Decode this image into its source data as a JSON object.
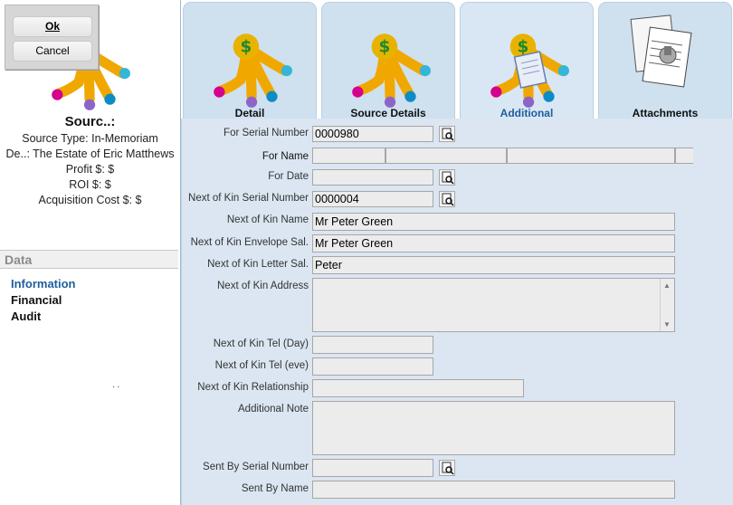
{
  "dialog": {
    "ok_label": "Ok",
    "cancel_label": "Cancel"
  },
  "summary": {
    "title": "Sourc..:",
    "lines": [
      "Source Type: In-Memoriam",
      "De..: The Estate of Eric Matthews",
      "Profit $: $",
      "ROI $: $",
      "Acquisition Cost $: $"
    ]
  },
  "data_section": {
    "header": "Data",
    "items": [
      "Information",
      "Financial",
      "Audit"
    ],
    "active": "Information"
  },
  "footer_dots": ". .",
  "tabs": [
    {
      "label": "Detail",
      "icon": "source-hand-icon"
    },
    {
      "label": "Source Details",
      "icon": "source-hand-icon"
    },
    {
      "label": "Additional",
      "icon": "hand-notepad-icon"
    },
    {
      "label": "Attachments",
      "icon": "paperclip-documents-icon"
    }
  ],
  "active_tab": "Additional",
  "form": {
    "for_serial_number": {
      "label": "For Serial Number",
      "value": "0000980"
    },
    "for_name": {
      "label": "For Name",
      "parts": [
        "",
        "",
        "",
        ""
      ]
    },
    "for_date": {
      "label": "For Date",
      "value": ""
    },
    "nok_serial_number": {
      "label": "Next of Kin Serial Number",
      "value": "0000004"
    },
    "nok_name": {
      "label": "Next of Kin Name",
      "value": "Mr Peter Green"
    },
    "nok_envelope_sal": {
      "label": "Next of Kin Envelope Sal.",
      "value": "Mr Peter Green"
    },
    "nok_letter_sal": {
      "label": "Next of Kin Letter Sal.",
      "value": "Peter"
    },
    "nok_address": {
      "label": "Next of Kin Address",
      "value": ""
    },
    "nok_tel_day": {
      "label": "Next of Kin Tel (Day)",
      "value": ""
    },
    "nok_tel_eve": {
      "label": "Next of Kin Tel (eve)",
      "value": ""
    },
    "nok_relationship": {
      "label": "Next of Kin Relationship",
      "value": ""
    },
    "additional_note": {
      "label": "Additional Note",
      "value": ""
    },
    "sent_by_serial_number": {
      "label": "Sent By Serial Number",
      "value": ""
    },
    "sent_by_name": {
      "label": "Sent By Name",
      "value": ""
    }
  },
  "colors": {
    "tab_bg": "#cfe0ef",
    "form_bg": "#dbe6f2",
    "active_text": "#1f5e9c"
  }
}
